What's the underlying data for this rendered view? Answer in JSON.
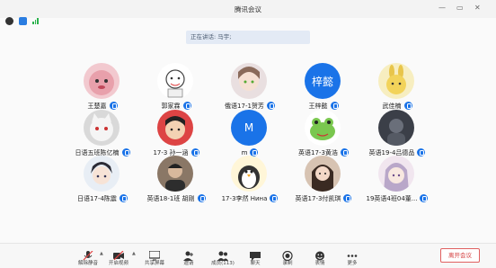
{
  "window": {
    "title": "腾讯会议",
    "minimize": "—",
    "maximize": "▭",
    "close": "✕"
  },
  "status": {
    "speaking_label": "正在讲话: 马宇;"
  },
  "participants": [
    {
      "name": "王楚嘉",
      "avatar": "pink-plush-avatar",
      "initials": ""
    },
    {
      "name": "郭家霖",
      "avatar": "cartoon-sketch-avatar",
      "initials": ""
    },
    {
      "name": "俄语17-1贺芳",
      "avatar": "anime-girl-avatar",
      "initials": ""
    },
    {
      "name": "王梓懿",
      "avatar": "text-avatar",
      "initials": "梓懿"
    },
    {
      "name": "武佳楠",
      "avatar": "yellow-bunny-avatar",
      "initials": ""
    },
    {
      "name": "日语五班陈亿楠",
      "avatar": "white-cat-avatar",
      "initials": ""
    },
    {
      "name": "17-3 孙一涵",
      "avatar": "cartoon-kid-avatar",
      "initials": ""
    },
    {
      "name": "m",
      "avatar": "text-avatar",
      "initials": "M"
    },
    {
      "name": "英语17-3黄浩",
      "avatar": "green-frog-avatar",
      "initials": ""
    },
    {
      "name": "英语19-4吕德品",
      "avatar": "dark-photo-avatar",
      "initials": ""
    },
    {
      "name": "日语17-4陈震",
      "avatar": "anime-boy-avatar",
      "initials": ""
    },
    {
      "name": "英语18-1班 胡刚",
      "avatar": "person-photo-avatar",
      "initials": ""
    },
    {
      "name": "17-3李然 Нина",
      "avatar": "penguin-avatar",
      "initials": ""
    },
    {
      "name": "英语17-3付凯琪",
      "avatar": "girl-photo-avatar",
      "initials": ""
    },
    {
      "name": "19英语4班04董...",
      "avatar": "anime-girl2-avatar",
      "initials": ""
    }
  ],
  "toolbar": {
    "unmute": "解除静音",
    "video": "开启视频",
    "share": "共享屏幕",
    "invite": "邀请",
    "members": "成员(113)",
    "chat": "聊天",
    "record": "录制",
    "reactions": "表情",
    "more": "更多",
    "leave": "离开会议"
  },
  "colors": {
    "accent": "#1a73e8",
    "leave": "#d43c3c"
  }
}
